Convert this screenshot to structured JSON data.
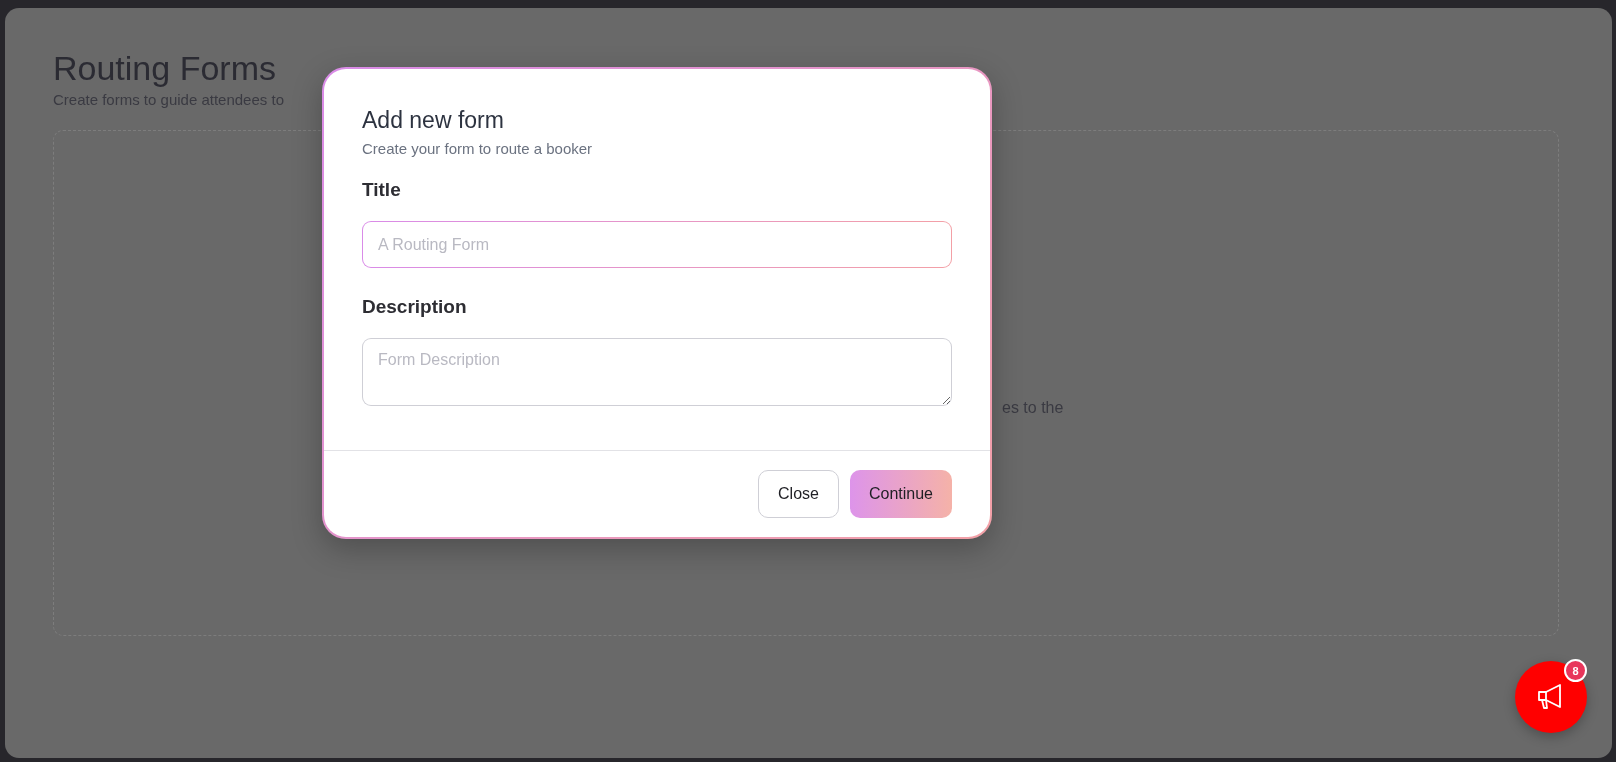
{
  "page": {
    "title": "Routing Forms",
    "subtitle": "Create forms to guide attendees to",
    "empty_state_fragment": "es to the"
  },
  "dialog": {
    "title": "Add new form",
    "subtitle": "Create your form to route a booker",
    "fields": [
      {
        "kind": "input",
        "label": "Title",
        "placeholder": "A Routing Form",
        "focused": true
      },
      {
        "kind": "textarea",
        "label": "Description",
        "placeholder": "Form Description",
        "focused": false
      }
    ],
    "buttons": [
      {
        "kind": "secondary",
        "label": "Close"
      },
      {
        "kind": "primary",
        "label": "Continue"
      }
    ]
  },
  "announcements": {
    "badge": "8"
  }
}
